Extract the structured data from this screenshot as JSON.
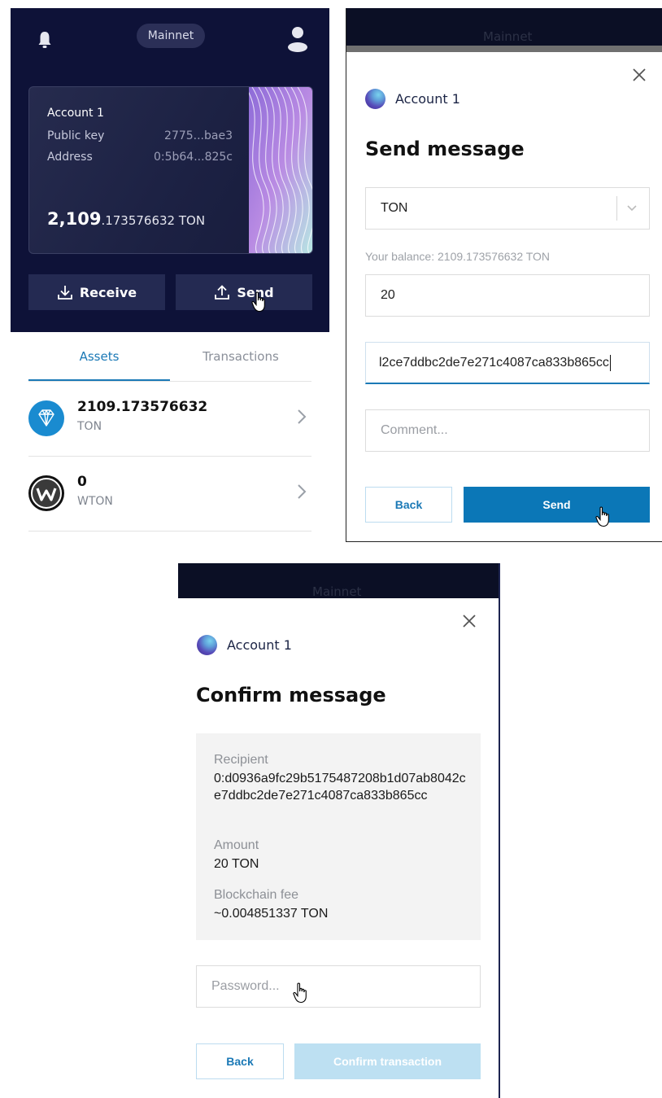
{
  "wallet": {
    "network": "Mainnet",
    "account_name": "Account 1",
    "public_key_label": "Public key",
    "public_key_value": "2775...bae3",
    "address_label": "Address",
    "address_value": "0:5b64...825c",
    "balance_int": "2,109",
    "balance_frac": ".173576632 TON",
    "receive_label": "Receive",
    "send_label": "Send",
    "tabs": [
      "Assets",
      "Transactions"
    ],
    "assets": [
      {
        "amount": "2109.173576632",
        "symbol": "TON"
      },
      {
        "amount": "0",
        "symbol": "WTON"
      }
    ],
    "colors": {
      "header": "#0e1238",
      "accent": "#1b79b6"
    }
  },
  "send_dialog": {
    "network": "Mainnet",
    "account_name": "Account 1",
    "title": "Send message",
    "token_selected": "TON",
    "balance_text": "Your balance: 2109.173576632 TON",
    "amount_value": "20",
    "recipient_value": "l2ce7ddbc2de7e271c4087ca833b865cc",
    "comment_placeholder": "Comment...",
    "back_label": "Back",
    "send_label": "Send",
    "colors": {
      "primary": "#0b77b7"
    }
  },
  "confirm_dialog": {
    "network": "Mainnet",
    "account_name": "Account 1",
    "title": "Confirm message",
    "recipient_label": "Recipient",
    "recipient_value": "0:d0936a9fc29b5175487208b1d07ab8042ce7ddbc2de7e271c4087ca833b865cc",
    "amount_label": "Amount",
    "amount_value": "20 TON",
    "fee_label": "Blockchain fee",
    "fee_value": "~0.004851337 TON",
    "password_placeholder": "Password...",
    "back_label": "Back",
    "confirm_label": "Confirm transaction",
    "colors": {
      "confirm_disabled": "#bde0f2"
    }
  }
}
